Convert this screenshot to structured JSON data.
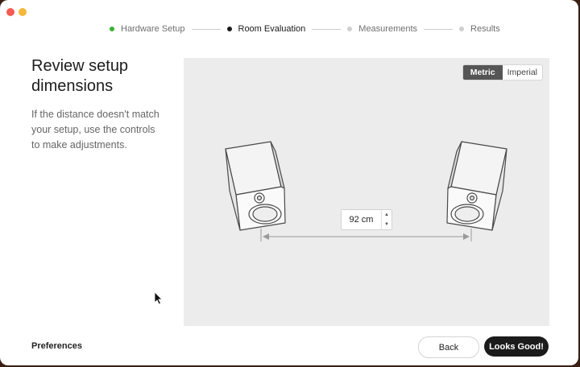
{
  "steps": [
    {
      "label": "Hardware Setup",
      "state": "done"
    },
    {
      "label": "Room Evaluation",
      "state": "active"
    },
    {
      "label": "Measurements",
      "state": "pending"
    },
    {
      "label": "Results",
      "state": "pending"
    }
  ],
  "content": {
    "title": "Review setup dimensions",
    "description": "If the distance doesn't match your setup, use the controls to make adjustments."
  },
  "units": {
    "metric_label": "Metric",
    "imperial_label": "Imperial",
    "selected": "Metric"
  },
  "distance": {
    "value": "92 cm"
  },
  "footer": {
    "preferences_label": "Preferences",
    "back_label": "Back",
    "confirm_label": "Looks Good!"
  },
  "colors": {
    "step_done": "#36b336",
    "accent_dark": "#1b1b1b",
    "canvas_bg": "#ececec"
  }
}
